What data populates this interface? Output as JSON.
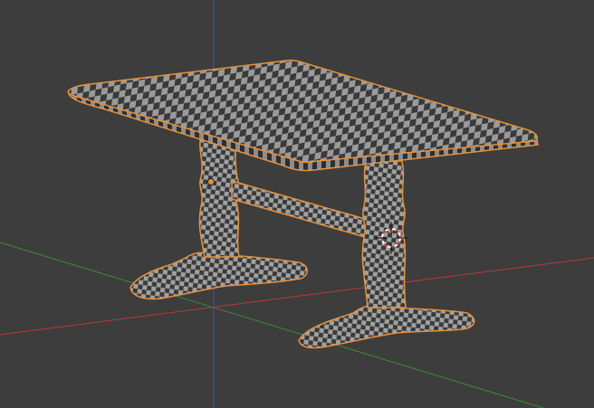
{
  "viewport": {
    "mode": "3d-viewport",
    "background_color": "#3d3d3d",
    "axes": {
      "x_axis_color": "#b83b3b",
      "y_axis_color": "#3c8a3c",
      "z_axis_color": "#3d4fa6"
    }
  },
  "object": {
    "kind": "table-mesh",
    "selected": true,
    "outline_color": "#e8913a",
    "texture": "checker-texture",
    "checker_dark": "#3a3a3a",
    "checker_light": "#9a9a9a"
  },
  "gizmos": {
    "origin_point": "object-origin-icon",
    "cursor": "3d-cursor-icon",
    "cursor_colors": [
      "#d23a3a",
      "#ffffff"
    ]
  }
}
